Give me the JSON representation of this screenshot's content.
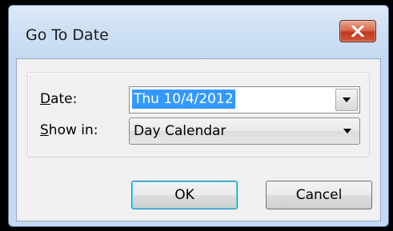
{
  "window": {
    "title": "Go To Date"
  },
  "icons": {
    "close": "close-icon",
    "dropdown": "chevron-down-icon"
  },
  "date_field": {
    "label_mnemonic": "D",
    "label_rest": "ate:",
    "value": "Thu 10/4/2012"
  },
  "show_in_field": {
    "label_mnemonic": "S",
    "label_rest": "how in:",
    "selected": "Day Calendar"
  },
  "buttons": {
    "ok": "OK",
    "cancel": "Cancel"
  },
  "colors": {
    "selection": "#3399ff",
    "close_button": "#c7432a",
    "title_bar": "#cfe0f4",
    "default_button_border": "#3c7fb1"
  }
}
